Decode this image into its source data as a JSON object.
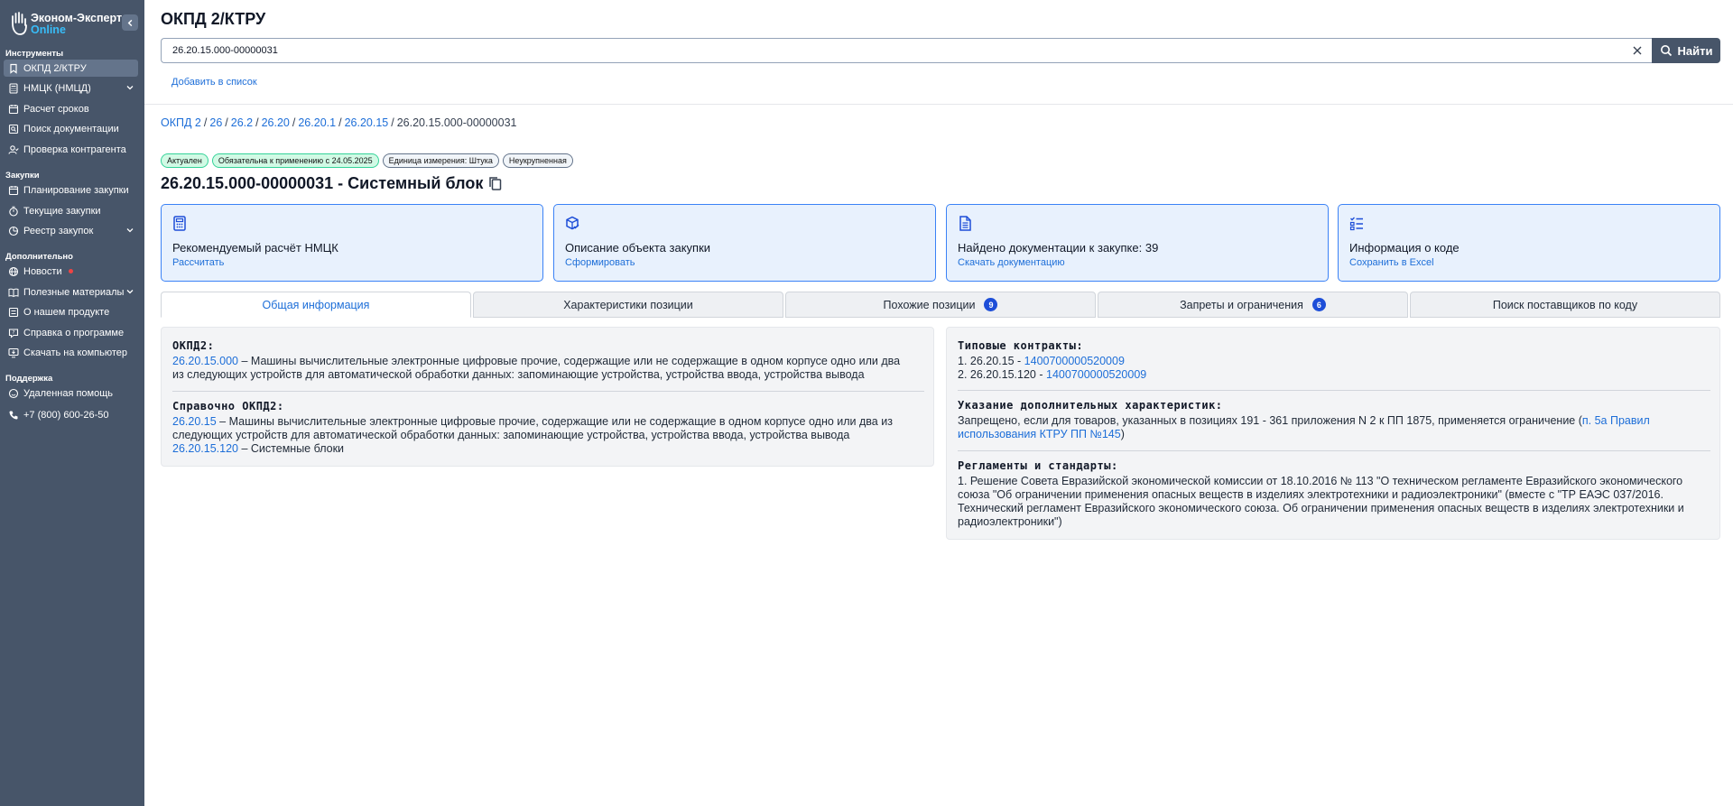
{
  "brand": {
    "name": "Эконом-Эксперт",
    "sub": "Online"
  },
  "sidebar": {
    "sections": [
      {
        "title": "Инструменты"
      },
      {
        "title": "Закупки"
      },
      {
        "title": "Дополнительно"
      },
      {
        "title": "Поддержка"
      }
    ],
    "items": [
      {
        "label": "ОКПД 2/КТРУ",
        "icon": "bookmark-icon"
      },
      {
        "label": "НМЦК (НМЦД)",
        "icon": "calculator-icon"
      },
      {
        "label": "Расчет сроков",
        "icon": "calendar-icon"
      },
      {
        "label": "Поиск документации",
        "icon": "doc-search-icon"
      },
      {
        "label": "Проверка контрагента",
        "icon": "user-check-icon"
      },
      {
        "label": "Планирование закупки",
        "icon": "calendar-icon"
      },
      {
        "label": "Текущие закупки",
        "icon": "timer-icon"
      },
      {
        "label": "Реестр закупок",
        "icon": "pie-icon"
      },
      {
        "label": "Новости",
        "icon": "globe-icon"
      },
      {
        "label": "Полезные материалы",
        "icon": "book-icon"
      },
      {
        "label": "О нашем продукте",
        "icon": "list-icon"
      },
      {
        "label": "Справка о программе",
        "icon": "help-icon"
      },
      {
        "label": "Скачать на компьютер",
        "icon": "monitor-download-icon"
      },
      {
        "label": "Удаленная помощь",
        "icon": "smile-icon"
      },
      {
        "label": "+7 (800) 600-26-50",
        "icon": "phone-icon"
      }
    ]
  },
  "header": {
    "title": "ОКПД 2/КТРУ",
    "search_value": "26.20.15.000-00000031",
    "search_button": "Найти",
    "add_to_list": "Добавить в список"
  },
  "breadcrumb": {
    "links": [
      "ОКПД 2",
      "26",
      "26.2",
      "26.20",
      "26.20.1",
      "26.20.15"
    ],
    "current": "26.20.15.000-00000031"
  },
  "badges": [
    "Актуален",
    "Обязательна к применению с 24.05.2025",
    "Единица измерения: Штука",
    "Неукрупненная"
  ],
  "item_title": "26.20.15.000-00000031 - Системный блок",
  "cards": [
    {
      "title": "Рекомендуемый расчёт НМЦК",
      "link": "Рассчитать",
      "icon": "calculator-icon"
    },
    {
      "title": "Описание объекта закупки",
      "link": "Сформировать",
      "icon": "box-check-icon"
    },
    {
      "title": "Найдено документации к закупке: 39",
      "link": "Скачать документацию",
      "icon": "document-icon"
    },
    {
      "title": "Информация о коде",
      "link": "Сохранить в Excel",
      "icon": "list-check-icon"
    }
  ],
  "tabs": [
    {
      "label": "Общая информация"
    },
    {
      "label": "Характеристики позиции"
    },
    {
      "label": "Похожие позиции",
      "count": "9"
    },
    {
      "label": "Запреты и ограничения",
      "count": "6"
    },
    {
      "label": "Поиск поставщиков по коду"
    }
  ],
  "general": {
    "okpd2_heading": "ОКПД2:",
    "okpd2_code": "26.20.15.000",
    "okpd2_text": " – Машины вычислительные электронные цифровые прочие, содержащие или не содержащие в одном корпусе одно или два из следующих устройств для автоматической обработки данных: запоминающие устройства, устройства ввода, устройства вывода",
    "ref_heading": "Справочно ОКПД2:",
    "ref1_code": "26.20.15",
    "ref1_text": " – Машины вычислительные электронные цифровые прочие, содержащие или не содержащие в одном корпусе одно или два из следующих устройств для автоматической обработки данных: запоминающие устройства, устройства ввода, устройства вывода",
    "ref2_code": "26.20.15.120",
    "ref2_text": " – Системные блоки"
  },
  "contracts": {
    "heading": "Типовые контракты:",
    "items": [
      {
        "prefix": "1. 26.20.15 - ",
        "link": "1400700000520009"
      },
      {
        "prefix": "2. 26.20.15.120 - ",
        "link": "1400700000520009"
      }
    ]
  },
  "extra": {
    "heading": "Указание дополнительных характеристик:",
    "text": "Запрещено, если для товаров, указанных в позициях 191 - 361 приложения N 2 к ПП 1875, применяется ограничение (",
    "link": "п. 5а Правил использования КТРУ ПП №145",
    "suffix": ")"
  },
  "regulations": {
    "heading": "Регламенты и стандарты:",
    "text": "1. Решение Совета Евразийской экономической комиссии от 18.10.2016 № 113 \"О техническом регламенте Евразийского экономического союза \"Об ограничении применения опасных веществ в изделиях электротехники и радиоэлектроники\" (вместе с \"ТР ЕАЭС 037/2016. Технический регламент Евразийского экономического союза. Об ограничении применения опасных веществ в изделиях электротехники и радиоэлектроники\")"
  }
}
